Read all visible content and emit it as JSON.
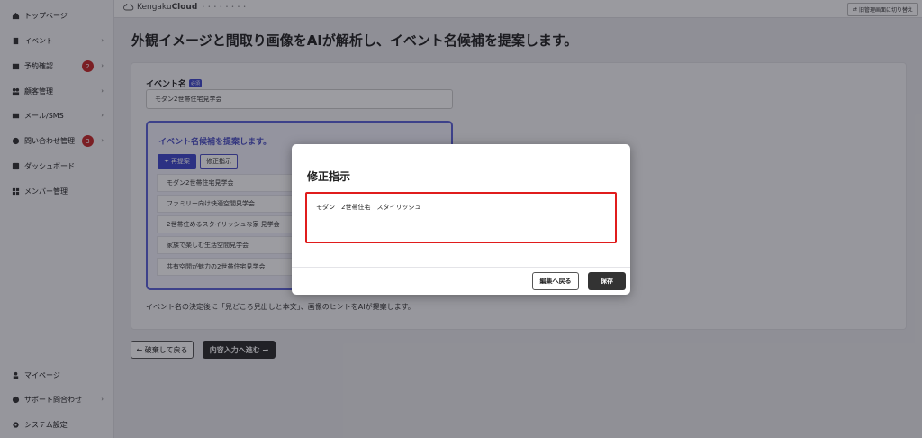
{
  "sidebar": {
    "items": [
      {
        "label": "トップページ",
        "icon": "home-icon"
      },
      {
        "label": "イベント",
        "icon": "document-icon",
        "chevron": "›"
      },
      {
        "label": "予約確認",
        "icon": "calendar-icon",
        "badge": "2",
        "chevron": "›"
      },
      {
        "label": "顧客管理",
        "icon": "users-icon",
        "chevron": "›"
      },
      {
        "label": "メール/SMS",
        "icon": "mail-icon",
        "chevron": "›"
      },
      {
        "label": "問い合わせ管理",
        "icon": "chat-icon",
        "badge": "3",
        "chevron": "›"
      },
      {
        "label": "ダッシュボード",
        "icon": "chart-icon"
      },
      {
        "label": "メンバー管理",
        "icon": "grid-icon"
      }
    ],
    "bottom_items": [
      {
        "label": "マイページ",
        "icon": "person-icon"
      },
      {
        "label": "サポート問合わせ",
        "icon": "help-icon",
        "chevron": "›"
      },
      {
        "label": "システム設定",
        "icon": "gear-icon"
      }
    ]
  },
  "topbar": {
    "logo_light": "Kengaku",
    "logo_bold": "Cloud",
    "logo_tag": "• • • • • • • •",
    "switch_label": "旧管理画面に切り替え"
  },
  "main": {
    "heading": "外観イメージと間取り画像をAIが解析し、イベント名候補を提案します。",
    "field_label": "イベント名",
    "required_tag": "必須",
    "field_value": "モダン2世帯住宅見学会",
    "suggest_title": "イベント名候補を提案します。",
    "regen_label": "再提案",
    "fix_label": "修正指示",
    "suggestions": [
      "モダン2世帯住宅見学会",
      "ファミリー向け快適空間見学会",
      "2世帯住めるスタイリッシュな家 見学会",
      "家族で楽しむ生活空間見学会",
      "共有空間が魅力の2世帯住宅見学会"
    ],
    "hint": "イベント名の決定後に「見どころ見出しと本文」、画像のヒントをAIが提案します。",
    "back_label": "← 破棄して戻る",
    "next_label": "内容入力へ進む →"
  },
  "modal": {
    "title": "修正指示",
    "text_value": "モダン　2世帯住宅　スタイリッシュ",
    "return_label": "編集へ戻る",
    "save_label": "保存"
  },
  "colors": {
    "accent": "#3f48cc",
    "badge": "#c62828",
    "highlight_border": "#e01c1c"
  }
}
